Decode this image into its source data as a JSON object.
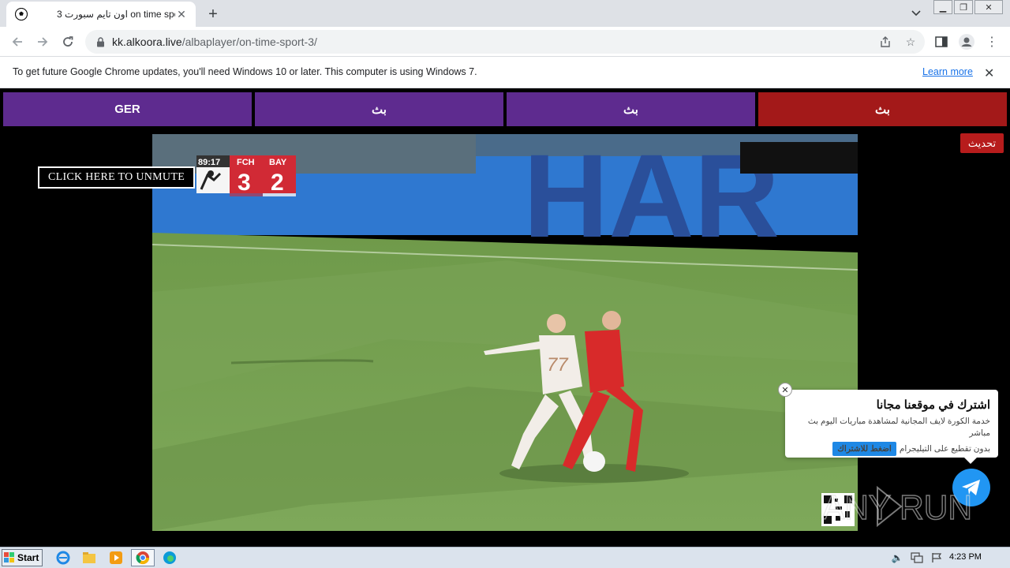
{
  "browser": {
    "tab_title": "اون تايم سبورت 3 on time sport",
    "url_host": "kk.alkoora.live",
    "url_path": "/albaplayer/on-time-sport-3/"
  },
  "infobar": {
    "message": "To get future Google Chrome updates, you'll need Windows 10 or later. This computer is using Windows 7.",
    "link": "Learn more"
  },
  "servers": [
    {
      "label": "GER",
      "color": "#5e2b8f"
    },
    {
      "label": "بث",
      "color": "#5e2b8f"
    },
    {
      "label": "بث",
      "color": "#5e2b8f"
    },
    {
      "label": "بث",
      "color": "#a31919"
    }
  ],
  "refresh_label": "تحديث",
  "unmute_label": "CLICK HERE TO UNMUTE",
  "scoreboard": {
    "time": "89:17",
    "home_team": "FCH",
    "away_team": "BAY",
    "home_score": "3",
    "away_score": "2",
    "player_number": "77",
    "ad_text": "HAR"
  },
  "popup": {
    "title": "اشترك في موقعنا مجانا",
    "body": "خدمة الكورة لايف المجانية لمشاهدة مباريات اليوم بث مباشر",
    "row_text": "بدون تقطيع على التيليجرام",
    "button": "اضغط للاشتراك"
  },
  "watermark": "ANY RUN",
  "taskbar": {
    "start_label": "Start",
    "clock": "4:23 PM"
  }
}
